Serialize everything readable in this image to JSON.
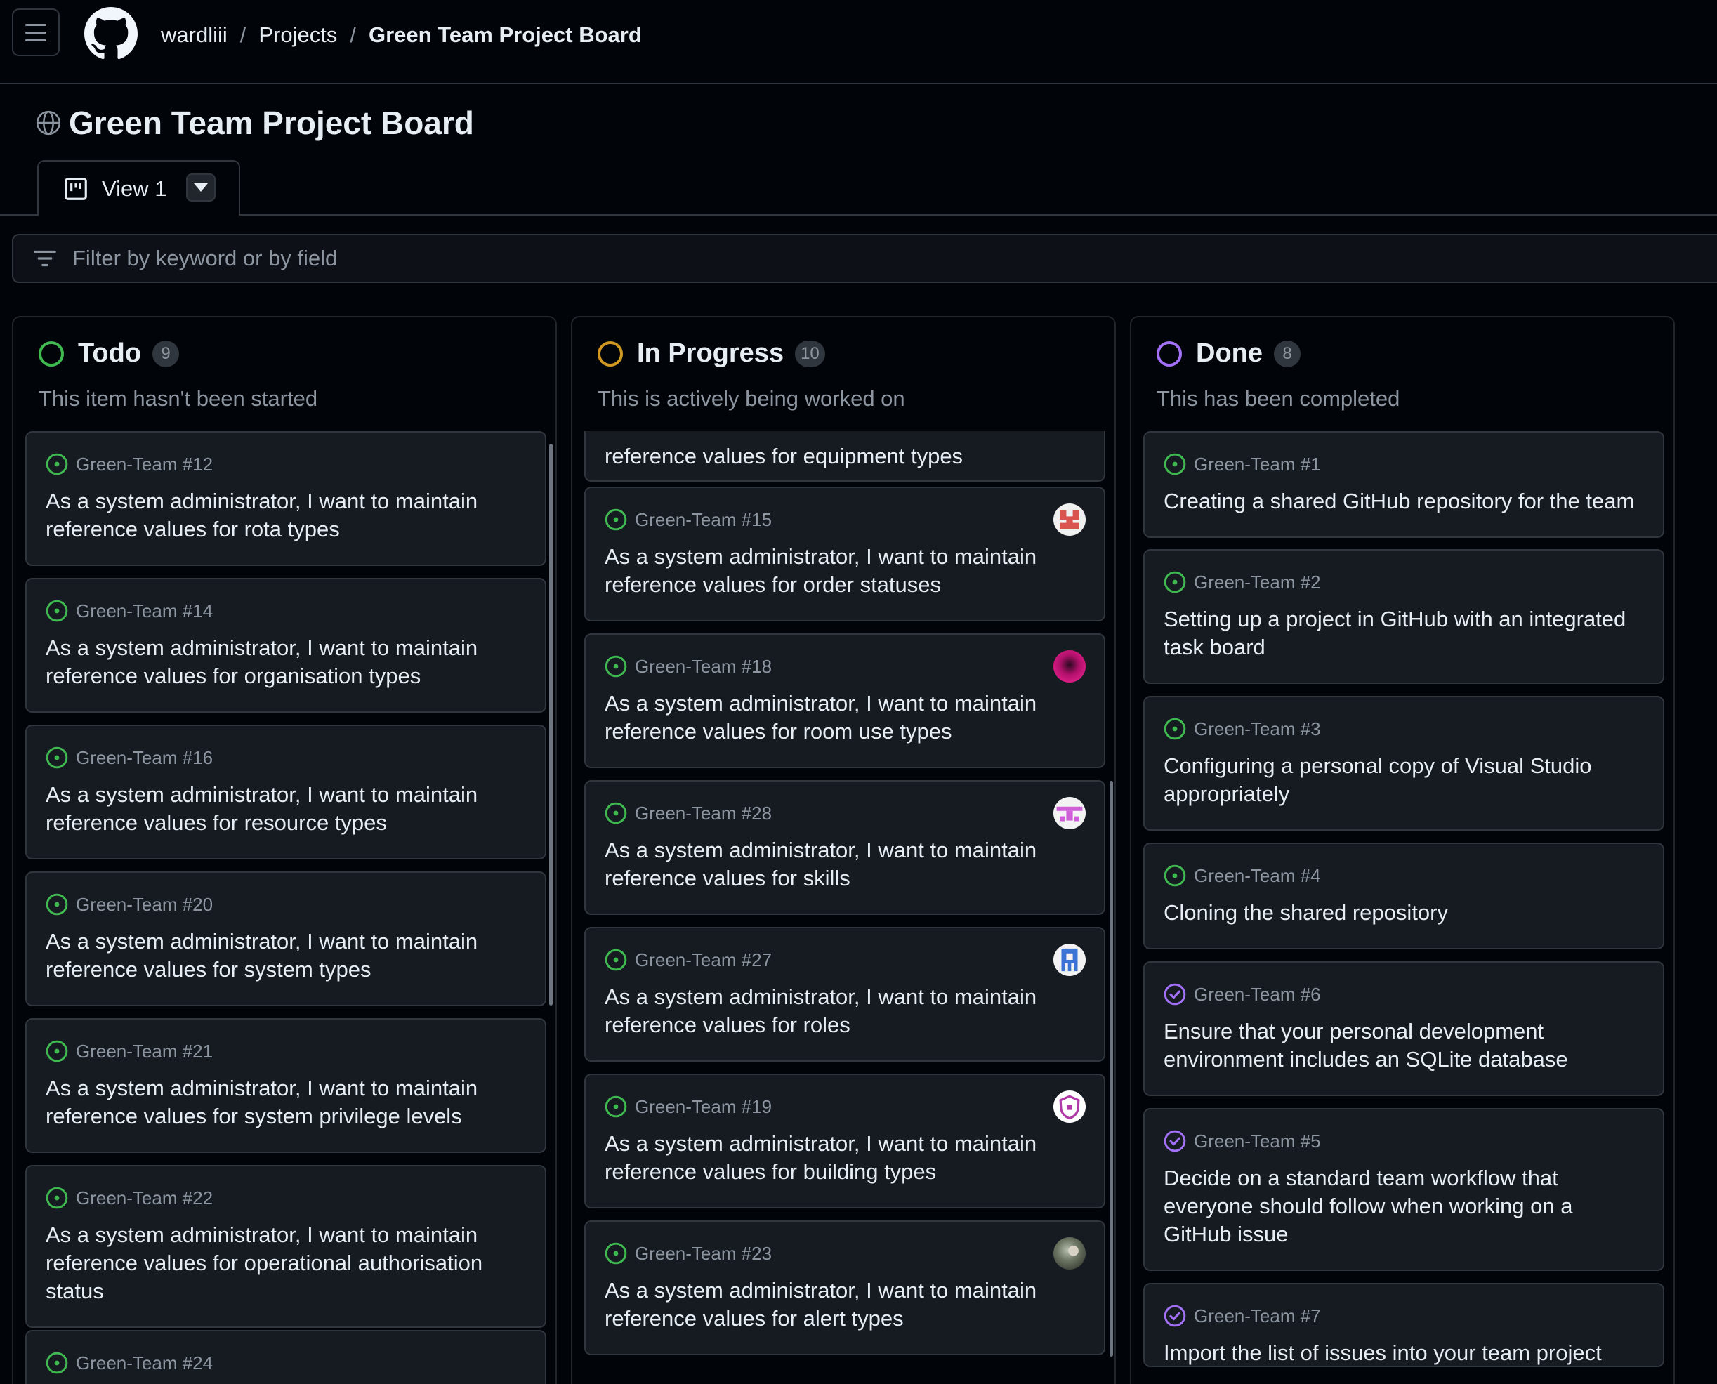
{
  "header": {
    "breadcrumb": [
      "wardliii",
      "Projects",
      "Green Team Project Board"
    ],
    "breadcrumb_separator": "/"
  },
  "page": {
    "title": "Green Team Project Board"
  },
  "tabs": [
    {
      "label": "View 1",
      "icon": "project-board-icon",
      "active": true
    }
  ],
  "filter": {
    "placeholder": "Filter by keyword or by field",
    "value": ""
  },
  "columns": [
    {
      "name": "Todo",
      "count": "9",
      "description": "This item hasn't been started",
      "color": "#3fb950",
      "items": [
        {
          "ref": "Green-Team #12",
          "title": "As a system administrator, I want to maintain reference values for rota types",
          "state": "open"
        },
        {
          "ref": "Green-Team #14",
          "title": "As a system administrator, I want to maintain reference values for organisation types",
          "state": "open"
        },
        {
          "ref": "Green-Team #16",
          "title": "As a system administrator, I want to maintain reference values for resource types",
          "state": "open"
        },
        {
          "ref": "Green-Team #20",
          "title": "As a system administrator, I want to maintain reference values for system types",
          "state": "open"
        },
        {
          "ref": "Green-Team #21",
          "title": "As a system administrator, I want to maintain reference values for system privilege levels",
          "state": "open"
        },
        {
          "ref": "Green-Team #22",
          "title": "As a system administrator, I want to maintain reference values for operational authorisation status",
          "state": "open"
        },
        {
          "ref": "Green-Team #24",
          "title": "",
          "state": "open"
        }
      ]
    },
    {
      "name": "In Progress",
      "count": "10",
      "description": "This is actively being worked on",
      "color": "#d29922",
      "items": [
        {
          "ref": "",
          "title": "reference values for equipment types",
          "state": "open"
        },
        {
          "ref": "Green-Team #15",
          "title": "As a system administrator, I want to maintain reference values for order statuses",
          "state": "open",
          "avatar": "avatar-red-pixel"
        },
        {
          "ref": "Green-Team #18",
          "title": "As a system administrator, I want to maintain reference values for room use types",
          "state": "open",
          "avatar": "avatar-pink-photo"
        },
        {
          "ref": "Green-Team #28",
          "title": "As a system administrator, I want to maintain reference values for skills",
          "state": "open",
          "avatar": "avatar-magenta-pixel"
        },
        {
          "ref": "Green-Team #27",
          "title": "As a system administrator, I want to maintain reference values for roles",
          "state": "open",
          "avatar": "avatar-blue-pixel"
        },
        {
          "ref": "Green-Team #19",
          "title": "As a system administrator, I want to maintain reference values for building types",
          "state": "open",
          "avatar": "avatar-purple-shield"
        },
        {
          "ref": "Green-Team #23",
          "title": "As a system administrator, I want to maintain reference values for alert types",
          "state": "open",
          "avatar": "avatar-grey-photo"
        }
      ]
    },
    {
      "name": "Done",
      "count": "8",
      "description": "This has been completed",
      "color": "#a371f7",
      "items": [
        {
          "ref": "Green-Team #1",
          "title": "Creating a shared GitHub repository for the team",
          "state": "open"
        },
        {
          "ref": "Green-Team #2",
          "title": "Setting up a project in GitHub with an integrated task board",
          "state": "open"
        },
        {
          "ref": "Green-Team #3",
          "title": "Configuring a personal copy of Visual Studio appropriately",
          "state": "open"
        },
        {
          "ref": "Green-Team #4",
          "title": "Cloning the shared repository",
          "state": "open"
        },
        {
          "ref": "Green-Team #6",
          "title": "Ensure that your personal development environment includes an SQLite database",
          "state": "closed"
        },
        {
          "ref": "Green-Team #5",
          "title": "Decide on a standard team workflow that everyone should follow when working on a GitHub issue",
          "state": "closed"
        },
        {
          "ref": "Green-Team #7",
          "title": "Import the list of issues into your team project",
          "state": "closed"
        }
      ]
    }
  ],
  "colors": {
    "open_issue": "#3fb950",
    "closed_issue": "#a371f7",
    "background": "#010409",
    "card": "#161b22",
    "border": "#30363d",
    "muted_text": "#8d96a0"
  }
}
